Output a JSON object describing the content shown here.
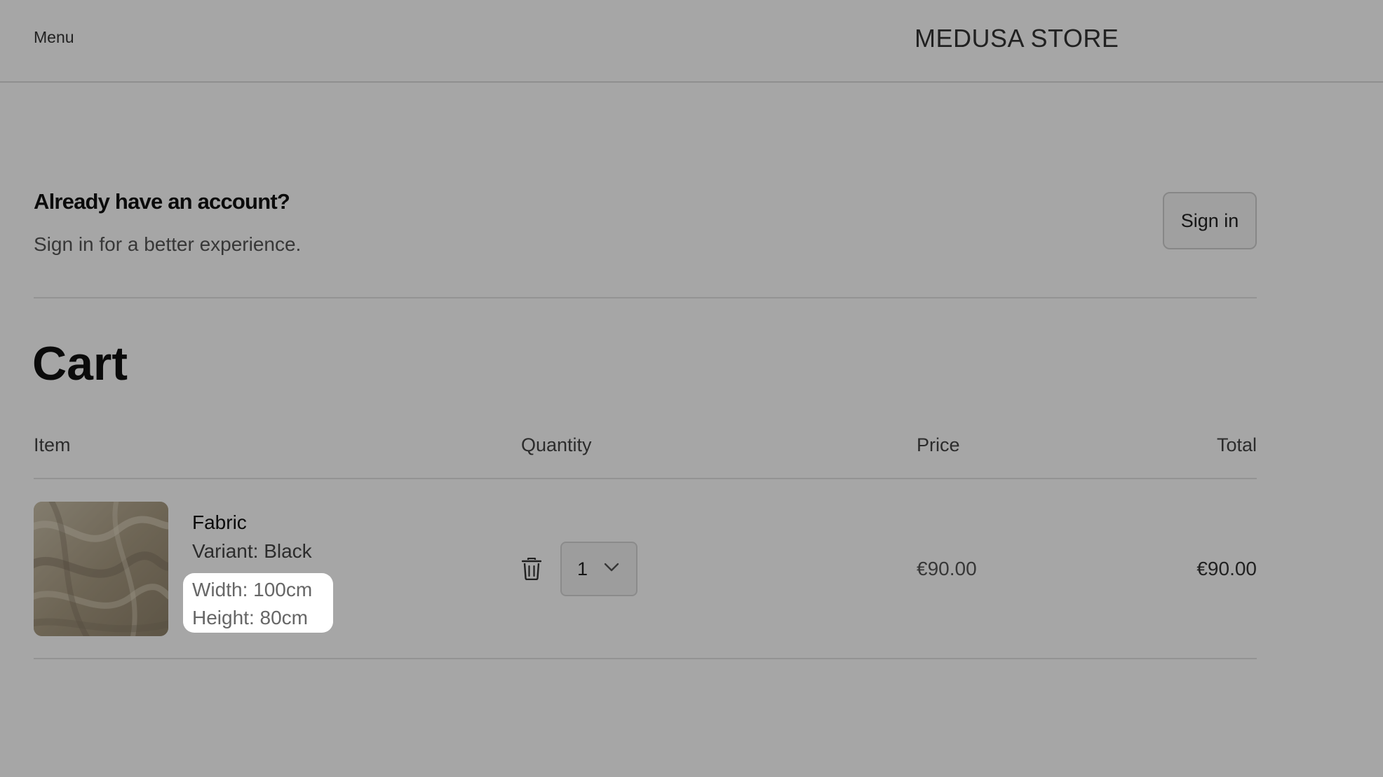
{
  "header": {
    "menu_label": "Menu",
    "store_name": "MEDUSA STORE"
  },
  "account": {
    "heading": "Already have an account?",
    "subtext": "Sign in for a better experience.",
    "signin_label": "Sign in"
  },
  "cart": {
    "title": "Cart",
    "columns": {
      "item": "Item",
      "quantity": "Quantity",
      "price": "Price",
      "total": "Total"
    },
    "items": [
      {
        "name": "Fabric",
        "variant": "Variant: Black",
        "attributes": [
          "Width: 100cm",
          "Height: 80cm"
        ],
        "quantity": "1",
        "price": "€90.00",
        "total": "€90.00"
      }
    ]
  },
  "icons": {
    "delete": "trash-icon",
    "quantity_dropdown": "chevron-down-icon"
  },
  "colors": {
    "overlay": "#000000",
    "highlight": "#ffffff"
  }
}
